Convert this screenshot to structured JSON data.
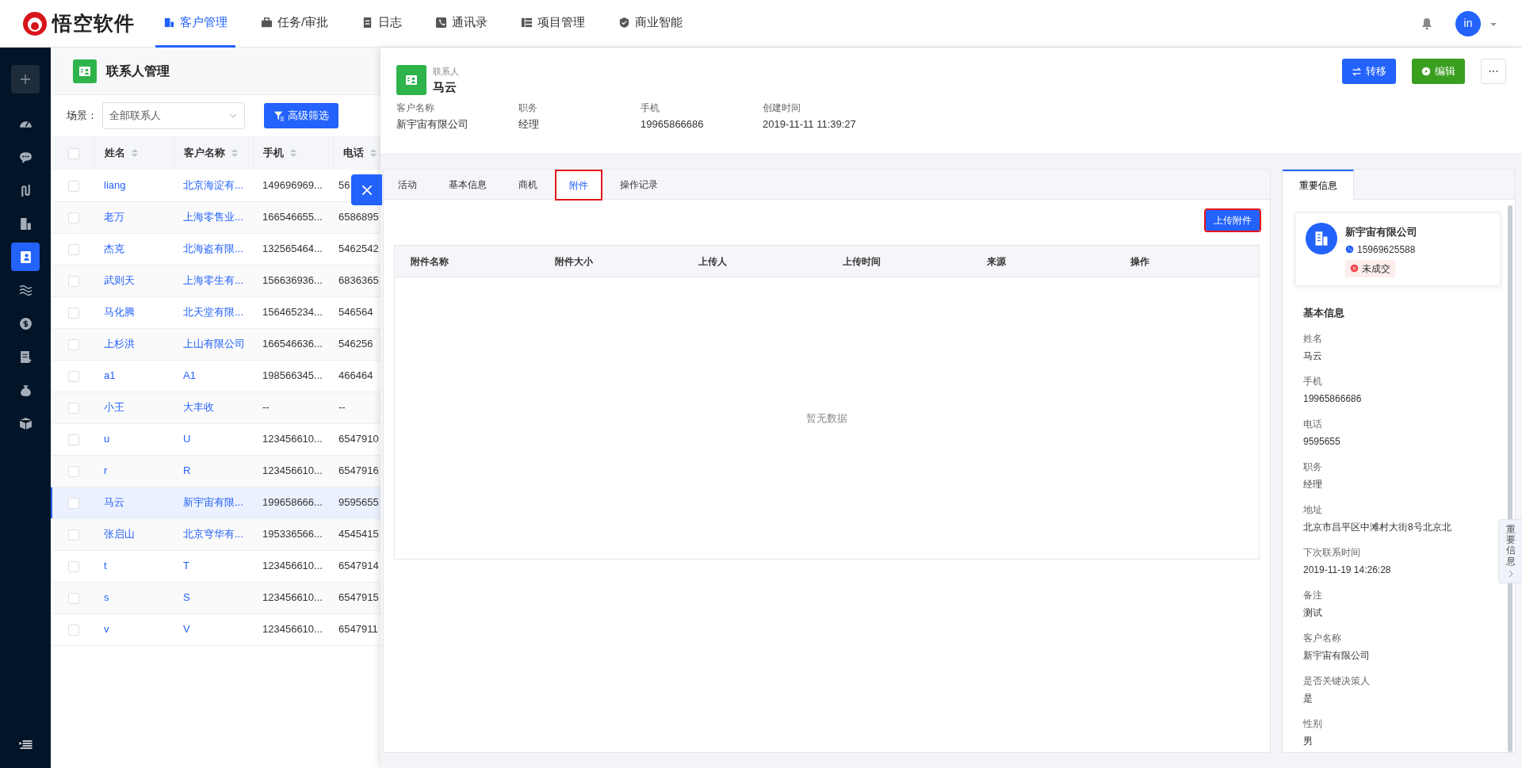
{
  "nav": {
    "brand": "悟空软件",
    "items": [
      {
        "label": "客户管理",
        "selected": true
      },
      {
        "label": "任务/审批",
        "selected": false
      },
      {
        "label": "日志",
        "selected": false
      },
      {
        "label": "通讯录",
        "selected": false
      },
      {
        "label": "项目管理",
        "selected": false
      },
      {
        "label": "商业智能",
        "selected": false
      }
    ],
    "avatar": "in"
  },
  "sidebar": {
    "items": [
      {
        "selected": false
      },
      {
        "selected": false
      },
      {
        "selected": false
      },
      {
        "selected": false
      },
      {
        "selected": true
      },
      {
        "selected": false
      },
      {
        "selected": false
      },
      {
        "selected": false
      },
      {
        "selected": false
      },
      {
        "selected": false
      }
    ]
  },
  "list": {
    "title": "联系人管理",
    "scene_label": "场景：",
    "scene_value": "全部联系人",
    "filter_button": "高级筛选",
    "select_all_checked": false,
    "columns": [
      "姓名",
      "客户名称",
      "手机",
      "电话"
    ],
    "rows": [
      {
        "name": "liang",
        "customer": "北京海淀有...",
        "mobile": "149696969...",
        "phone": "56",
        "selected": false
      },
      {
        "name": "老万",
        "customer": "上海零售业...",
        "mobile": "166546655...",
        "phone": "6586895",
        "selected": false
      },
      {
        "name": "杰克",
        "customer": "北海盗有限...",
        "mobile": "132565464...",
        "phone": "5462542",
        "selected": false
      },
      {
        "name": "武则天",
        "customer": "上海零生有...",
        "mobile": "156636936...",
        "phone": "6836365",
        "selected": false
      },
      {
        "name": "马化腾",
        "customer": "北天堂有限...",
        "mobile": "156465234...",
        "phone": "546564",
        "selected": false
      },
      {
        "name": "上杉洪",
        "customer": "上山有限公司",
        "mobile": "166546636...",
        "phone": "546256",
        "selected": false
      },
      {
        "name": "a1",
        "customer": "A1",
        "mobile": "198566345...",
        "phone": "466464",
        "selected": false
      },
      {
        "name": "小王",
        "customer": "大丰收",
        "mobile": "--",
        "phone": "--",
        "selected": false
      },
      {
        "name": "u",
        "customer": "U",
        "mobile": "123456610...",
        "phone": "6547910",
        "selected": false
      },
      {
        "name": "r",
        "customer": "R",
        "mobile": "123456610...",
        "phone": "6547916",
        "selected": false
      },
      {
        "name": "马云",
        "customer": "新宇宙有限...",
        "mobile": "199658666...",
        "phone": "9595655",
        "selected": true
      },
      {
        "name": "张启山",
        "customer": "北京穹华有...",
        "mobile": "195336566...",
        "phone": "4545415",
        "selected": false
      },
      {
        "name": "t",
        "customer": "T",
        "mobile": "123456610...",
        "phone": "6547914",
        "selected": false
      },
      {
        "name": "s",
        "customer": "S",
        "mobile": "123456610...",
        "phone": "6547915",
        "selected": false
      },
      {
        "name": "v",
        "customer": "V",
        "mobile": "123456610...",
        "phone": "6547911",
        "selected": false
      }
    ]
  },
  "detail": {
    "type_label": "联系人",
    "name": "马云",
    "actions": [
      {
        "label": "转移",
        "kind": "transfer"
      },
      {
        "label": "编辑",
        "kind": "edit"
      }
    ],
    "fields": [
      {
        "label": "客户名称",
        "value": "新宇宙有限公司"
      },
      {
        "label": "职务",
        "value": "经理"
      },
      {
        "label": "手机",
        "value": "19965866686"
      },
      {
        "label": "创建时间",
        "value": "2019-11-11 11:39:27"
      }
    ],
    "tabs": [
      {
        "label": "活动",
        "selected": false,
        "highlighted": false
      },
      {
        "label": "基本信息",
        "selected": false,
        "highlighted": false
      },
      {
        "label": "商机",
        "selected": false,
        "highlighted": false
      },
      {
        "label": "附件",
        "selected": true,
        "highlighted": true
      },
      {
        "label": "操作记录",
        "selected": false,
        "highlighted": false
      }
    ],
    "upload_button": {
      "label": "上传附件",
      "highlighted": true
    },
    "columns": [
      "附件名称",
      "附件大小",
      "上传人",
      "上传时间",
      "来源",
      "操作"
    ],
    "empty_text": "暂无数据"
  },
  "side_panel": {
    "tabs": [
      {
        "label": "重要信息",
        "selected": true
      }
    ],
    "company": {
      "name": "新宇宙有限公司",
      "phone": "15969625588",
      "status": "未成交"
    },
    "section_title": "基本信息",
    "fields": [
      {
        "label": "姓名",
        "value": "马云"
      },
      {
        "label": "手机",
        "value": "19965866686"
      },
      {
        "label": "电话",
        "value": "9595655"
      },
      {
        "label": "职务",
        "value": "经理"
      },
      {
        "label": "地址",
        "value": "北京市昌平区中滩村大街8号北京北"
      },
      {
        "label": "下次联系时间",
        "value": "2019-11-19 14:26:28"
      },
      {
        "label": "备注",
        "value": "测试"
      },
      {
        "label": "客户名称",
        "value": "新宇宙有限公司"
      },
      {
        "label": "是否关键决策人",
        "value": "是"
      },
      {
        "label": "性别",
        "value": "男"
      }
    ],
    "side_tab": "重要信息"
  }
}
